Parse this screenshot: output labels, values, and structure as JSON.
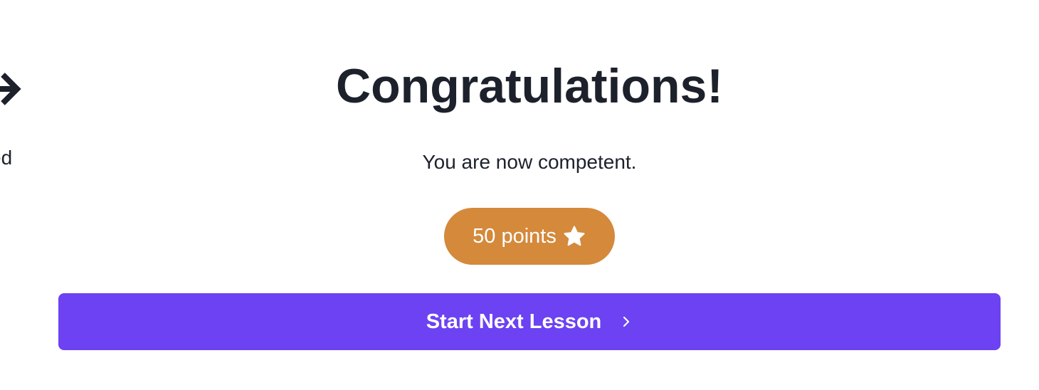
{
  "left_panel": {
    "partial_text": "ed",
    "icon": "arrow-right-icon"
  },
  "completion": {
    "title": "Congratulations!",
    "message": "You are now competent.",
    "points_badge": {
      "label": "50 points",
      "icon": "star-icon",
      "color": "#d4893b"
    },
    "next_button": {
      "label": "Start Next Lesson",
      "icon": "chevron-right-icon",
      "color": "#6c42f2"
    }
  }
}
